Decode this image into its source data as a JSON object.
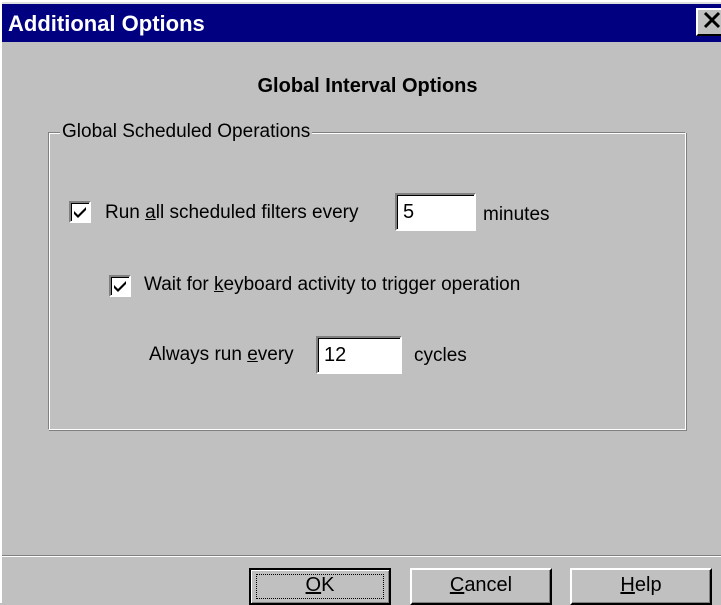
{
  "window": {
    "title": "Additional Options",
    "close_glyph": "✕"
  },
  "heading": "Global Interval Options",
  "group": {
    "legend": "Global Scheduled Operations",
    "run_all": {
      "checked": true,
      "label_pre": "Run ",
      "label_mnemonic": "a",
      "label_post": "ll scheduled filters every",
      "value": "5",
      "unit": "minutes"
    },
    "wait_keyboard": {
      "checked": true,
      "label_pre": "Wait for ",
      "label_mnemonic": "k",
      "label_post": "eyboard activity to trigger operation"
    },
    "always_run": {
      "label_pre": "Always run ",
      "label_mnemonic": "e",
      "label_post": "very",
      "value": "12",
      "unit": "cycles"
    }
  },
  "buttons": {
    "ok": {
      "mnemonic": "O",
      "rest": "K"
    },
    "cancel": {
      "mnemonic": "C",
      "rest": "ancel"
    },
    "help": {
      "mnemonic": "H",
      "rest": "elp"
    }
  },
  "colors": {
    "titlebar": "#000080",
    "face": "#c0c0c0"
  },
  "icons": {
    "close": "close-icon",
    "check": "checkmark-icon"
  }
}
